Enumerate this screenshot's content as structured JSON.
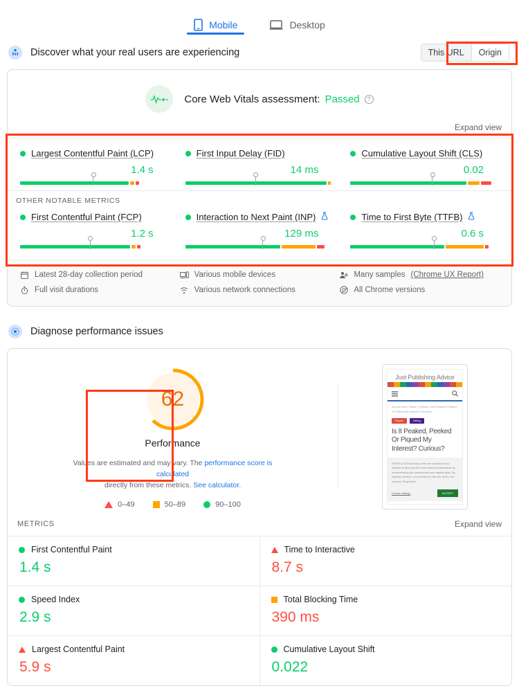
{
  "tabs": [
    {
      "label": "Mobile",
      "icon": "phone-icon",
      "active": true
    },
    {
      "label": "Desktop",
      "icon": "laptop-icon",
      "active": false
    }
  ],
  "field_section": {
    "title": "Discover what your real users are experiencing",
    "toggle": {
      "left": "This URL",
      "right": "Origin",
      "selected": "This URL"
    },
    "assessment": {
      "prefix": "Core Web Vitals assessment:",
      "result": "Passed",
      "help": "?"
    },
    "expand_label": "Expand view",
    "other_metrics_label": "OTHER NOTABLE METRICS",
    "core_metrics": [
      {
        "name": "Largest Contentful Paint (LCP)",
        "value": "1.4 s",
        "status": "good",
        "lab_icon": false,
        "bar": {
          "good": 73,
          "avg": 3,
          "poor": 2,
          "marker": 49
        }
      },
      {
        "name": "First Input Delay (FID)",
        "value": "14 ms",
        "status": "good",
        "lab_icon": false,
        "bar": {
          "good": 95,
          "avg": 2,
          "poor": 0,
          "marker": 47
        }
      },
      {
        "name": "Cumulative Layout Shift (CLS)",
        "value": "0.02",
        "status": "good",
        "lab_icon": false,
        "bar": {
          "good": 78,
          "avg": 8,
          "poor": 7,
          "marker": 55
        }
      }
    ],
    "other_notable_metrics": [
      {
        "name": "First Contentful Paint (FCP)",
        "value": "1.2 s",
        "status": "good",
        "lab_icon": false,
        "bar": {
          "good": 74,
          "avg": 3,
          "poor": 2,
          "marker": 47
        }
      },
      {
        "name": "Interaction to Next Paint (INP)",
        "value": "129 ms",
        "status": "good",
        "lab_icon": true,
        "bar": {
          "good": 64,
          "avg": 23,
          "poor": 5,
          "marker": 52
        }
      },
      {
        "name": "Time to First Byte (TTFB)",
        "value": "0.6 s",
        "status": "good",
        "lab_icon": true,
        "bar": {
          "good": 63,
          "avg": 26,
          "poor": 2,
          "marker": 56
        }
      }
    ],
    "meta": [
      {
        "icon": "calendar-icon",
        "text": "Latest 28-day collection period"
      },
      {
        "icon": "timer-icon",
        "text": "Full visit durations"
      },
      {
        "icon": "devices-icon",
        "text": "Various mobile devices"
      },
      {
        "icon": "wifi-icon",
        "text": "Various network connections"
      },
      {
        "icon": "people-icon",
        "text": "Many samples",
        "link": "(Chrome UX Report)"
      },
      {
        "icon": "chrome-icon",
        "text": "All Chrome versions"
      }
    ]
  },
  "diagnose_section": {
    "title": "Diagnose performance issues",
    "gauge": {
      "score": "62",
      "label": "Performance",
      "percent": 62,
      "color": "#ffa400",
      "text_color": "#e8710a"
    },
    "note": {
      "line1_a": "Values are estimated and may vary. The ",
      "line1_link": "performance score is calculated",
      "line2_a": "directly from these metrics. ",
      "line2_link": "See calculator."
    },
    "legend": [
      {
        "shape": "triangle",
        "range": "0–49",
        "color": "#ff4e42"
      },
      {
        "shape": "square",
        "range": "50–89",
        "color": "#ffa400"
      },
      {
        "shape": "circle",
        "range": "90–100",
        "color": "#0cce6b"
      }
    ],
    "screenshot": {
      "site_title": "Just Publishing Advice",
      "breadcrumb": "You are here: Home » Writing » Is It Peaked, Peeked Or Piqued My Interest? Curious?",
      "tags": [
        "Popular",
        "Writing"
      ],
      "headline": "Is It Peaked, Peeked Or Piqued My Interest? Curious?",
      "cookie_text": "GDPR & CCPA privacy: We use cookies on our website to give you the most relevant experience by remembering your preferences and repeat visits. By clicking “Accept”, you consent to the use of ALL the cookies. Read More",
      "cookie_settings": "Cookie settings",
      "cookie_accept": "ACCEPT"
    },
    "metrics_label": "METRICS",
    "metrics_expand": "Expand view",
    "lab_metrics": [
      [
        {
          "name": "First Contentful Paint",
          "value": "1.4 s",
          "status": "good"
        },
        {
          "name": "Time to Interactive",
          "value": "8.7 s",
          "status": "poor"
        }
      ],
      [
        {
          "name": "Speed Index",
          "value": "2.9 s",
          "status": "good"
        },
        {
          "name": "Total Blocking Time",
          "value": "390 ms",
          "status": "avg"
        }
      ],
      [
        {
          "name": "Largest Contentful Paint",
          "value": "5.9 s",
          "status": "poor"
        },
        {
          "name": "Cumulative Layout Shift",
          "value": "0.022",
          "status": "good"
        }
      ]
    ]
  },
  "colors": {
    "good": "#0cce6b",
    "average": "#ffa400",
    "poor": "#ff4e42",
    "accent": "#1a73e8",
    "annotation": "#ff3b13"
  }
}
